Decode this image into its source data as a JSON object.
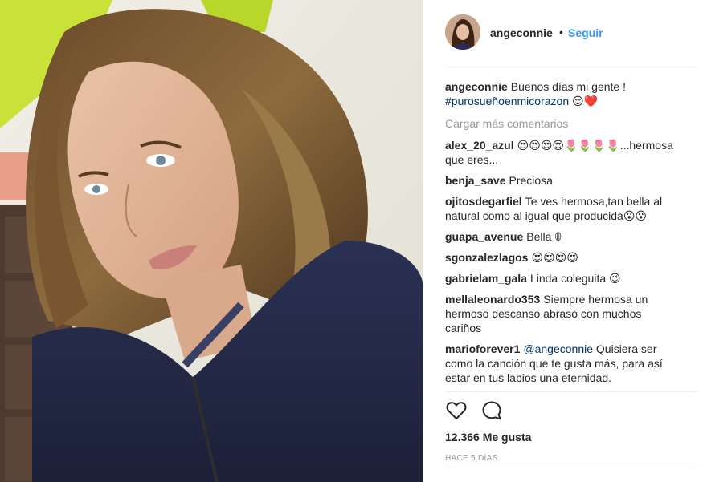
{
  "colors": {
    "link": "#3897f0",
    "hashtag": "#003569",
    "muted": "#999999",
    "text": "#262626"
  },
  "header": {
    "username": "angeconnie",
    "dot": "•",
    "follow_label": "Seguir"
  },
  "caption": {
    "username": "angeconnie",
    "text": "Buenos días mi gente !",
    "hashtag": "#purosueñoenmicorazon",
    "emoji": "😌❤️"
  },
  "load_more": "Cargar más comentarios",
  "comments": [
    {
      "user": "alex_20_azul",
      "text": "😍😍😍😍🌷🌷🌷🌷...hermosa que eres..."
    },
    {
      "user": "benja_save",
      "text": "Preciosa"
    },
    {
      "user": "ojitosdegarfiel",
      "text": "Te ves hermosa,tan bella al natural como al igual que producida😮😮"
    },
    {
      "user": "guapa_avenue",
      "text": "Bella 𝟘"
    },
    {
      "user": "sgonzalezlagos",
      "text": "😍😍😍😍"
    },
    {
      "user": "gabrielam_gala",
      "text": "Linda coleguita 😉"
    },
    {
      "user": "mellaleonardo353",
      "text": "Siempre hermosa un hermoso descanso abrasó con muchos cariños"
    },
    {
      "user": "marioforever1",
      "mention": "@angeconnie",
      "text": "Quisiera ser como la canción que te gusta más, para así estar en tus labios una eternidad."
    }
  ],
  "icons": {
    "like": "heart-outline-icon",
    "comment": "comment-bubble-icon"
  },
  "likes": "12.366 Me gusta",
  "timestamp": "HACE 5 DÍAS"
}
